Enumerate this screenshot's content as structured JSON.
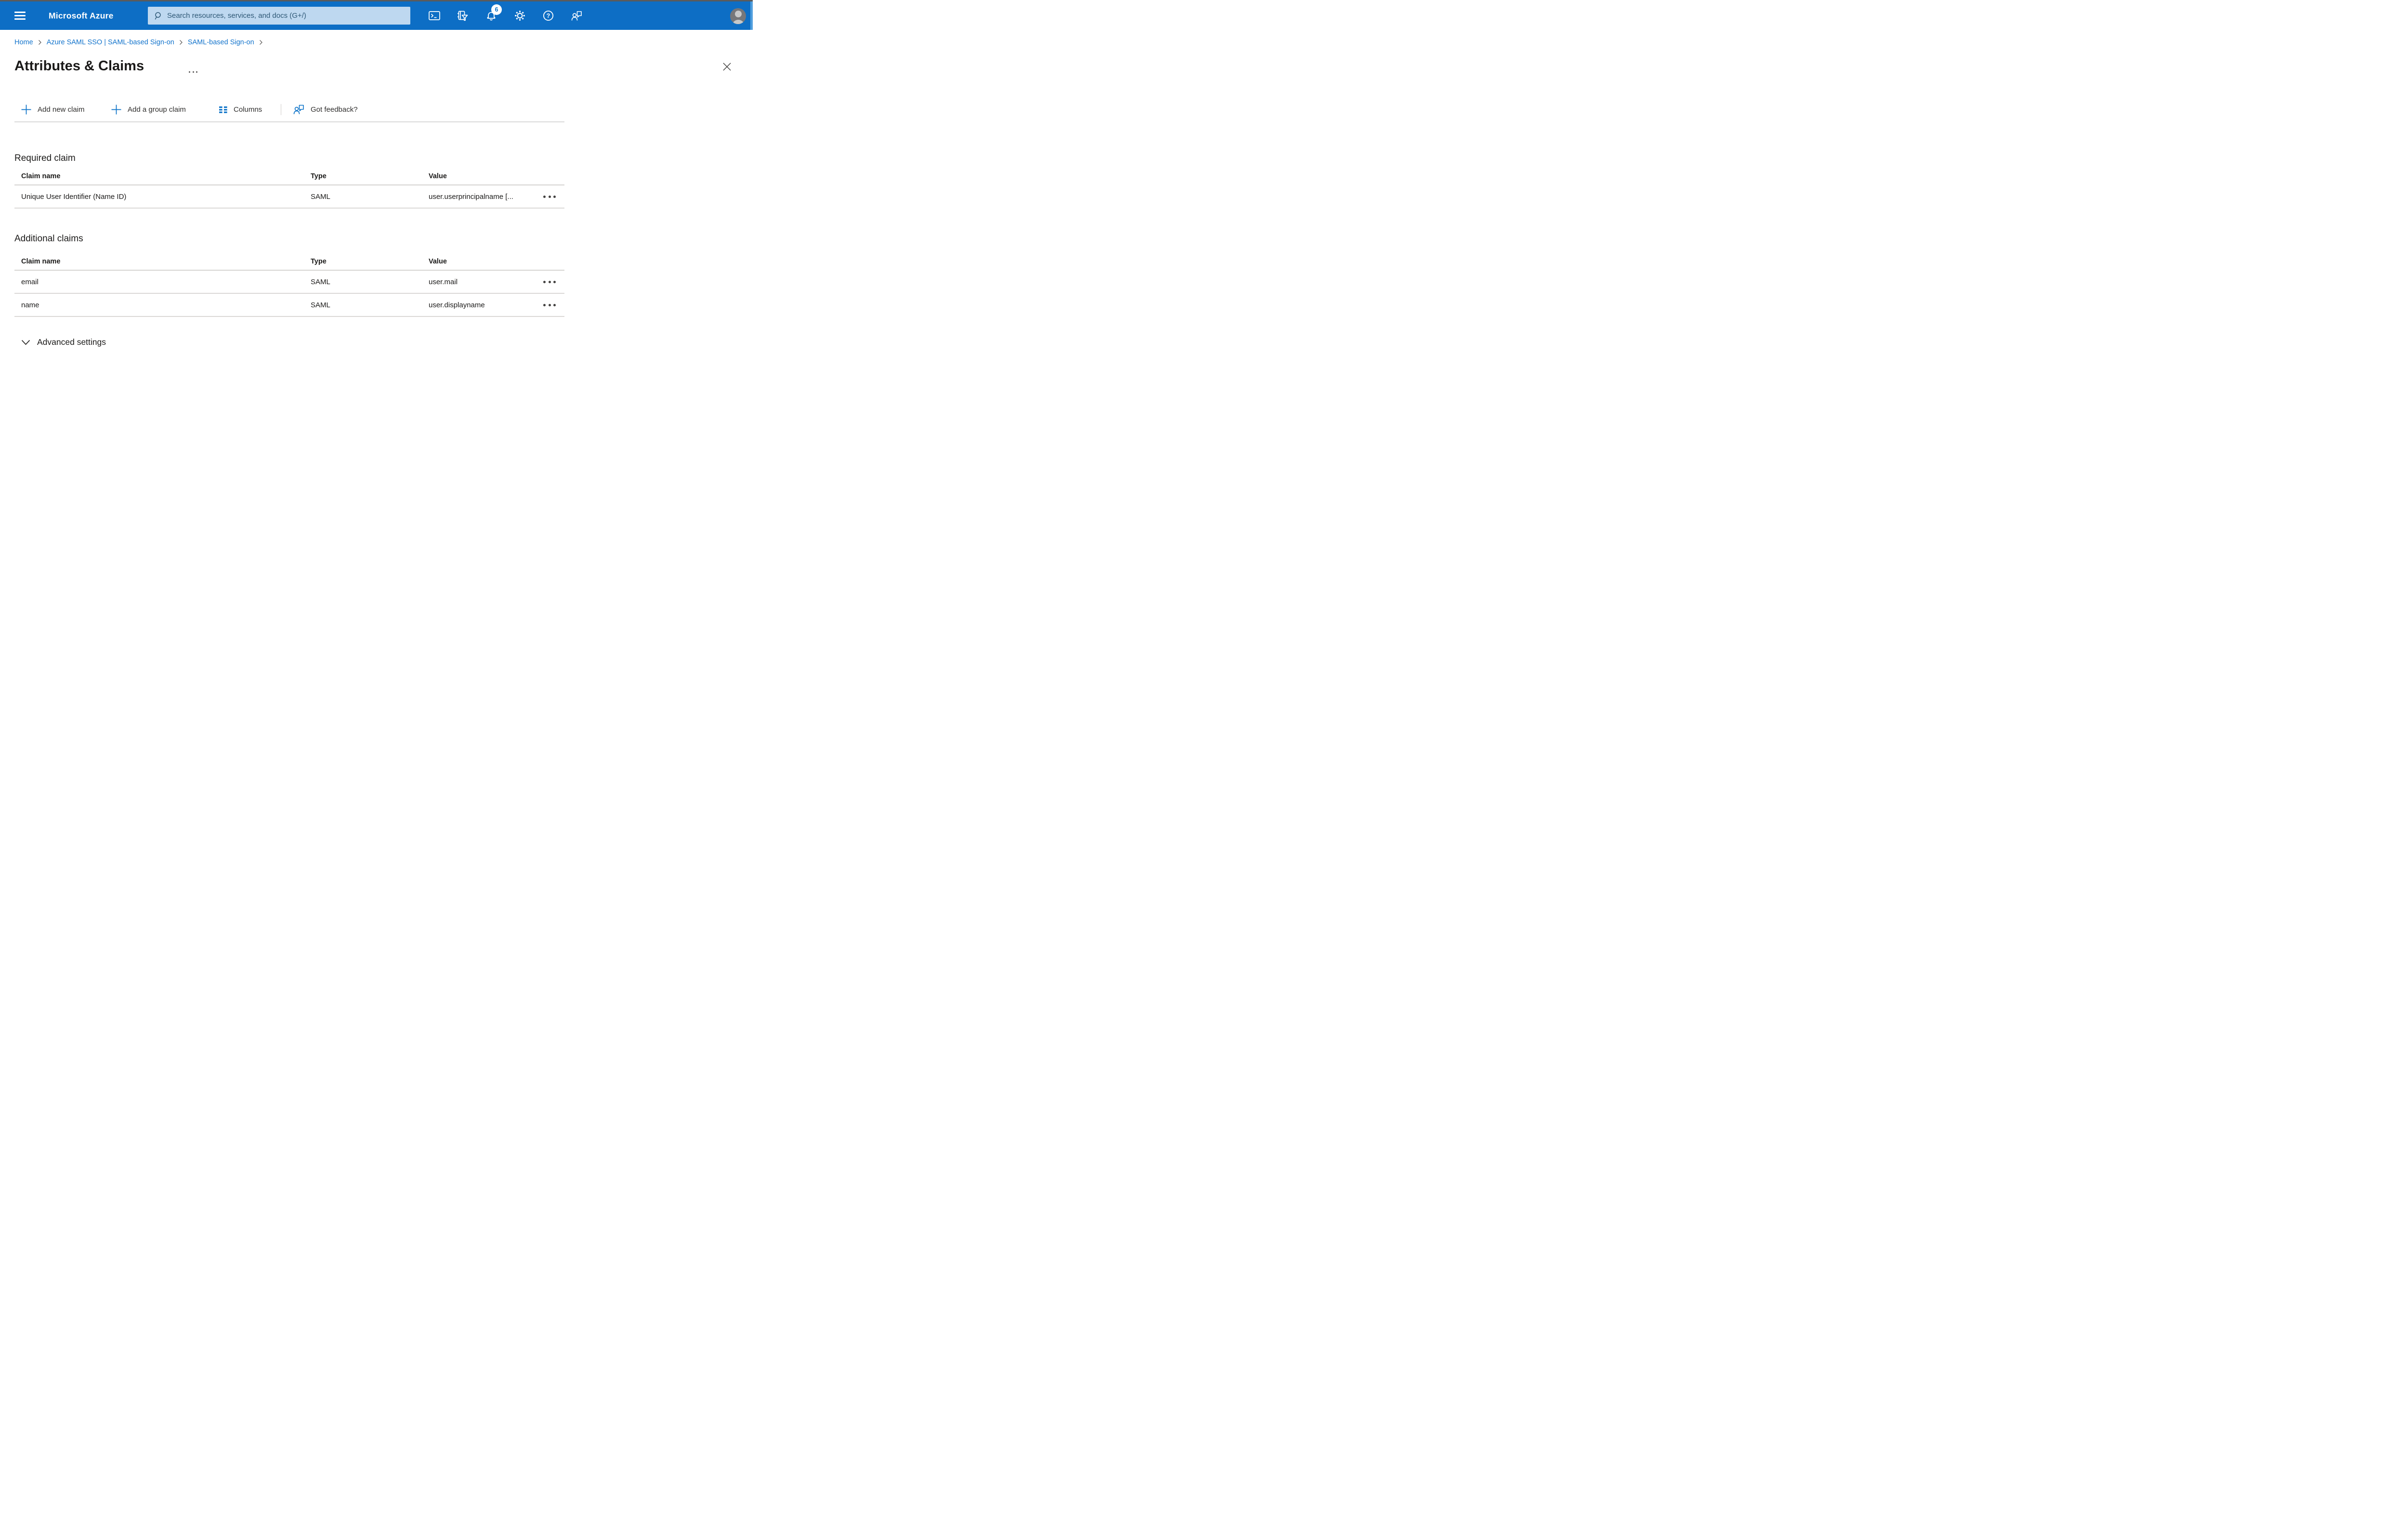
{
  "header": {
    "product": "Microsoft Azure",
    "search_placeholder": "Search resources, services, and docs (G+/)",
    "notifications_badge": "6",
    "icons": [
      "cloud-shell",
      "directories-filter",
      "notifications",
      "settings",
      "help",
      "feedback"
    ]
  },
  "breadcrumb": {
    "items": [
      "Home",
      "Azure SAML SSO | SAML-based Sign-on",
      "SAML-based Sign-on"
    ]
  },
  "page": {
    "title": "Attributes & Claims"
  },
  "toolbar": {
    "add_new_claim": "Add new claim",
    "add_group_claim": "Add a group claim",
    "columns": "Columns",
    "feedback": "Got feedback?"
  },
  "sections": {
    "required_claim": {
      "heading": "Required claim",
      "columns": [
        "Claim name",
        "Type",
        "Value"
      ],
      "rows": [
        {
          "name": "Unique User Identifier (Name ID)",
          "type": "SAML",
          "value": "user.userprincipalname [..."
        }
      ]
    },
    "additional_claims": {
      "heading": "Additional claims",
      "columns": [
        "Claim name",
        "Type",
        "Value"
      ],
      "rows": [
        {
          "name": "email",
          "type": "SAML",
          "value": "user.mail"
        },
        {
          "name": "name",
          "type": "SAML",
          "value": "user.displayname"
        }
      ]
    }
  },
  "advanced": {
    "label": "Advanced settings"
  },
  "colors": {
    "header_blue": "#0d6ec5",
    "accent_blue": "#0b72c8",
    "search_bg": "#bed8f0",
    "search_fg": "#2e5876",
    "link_blue": "#1374cc",
    "divider": "#d8d6d4",
    "text": "#1b1a19"
  }
}
